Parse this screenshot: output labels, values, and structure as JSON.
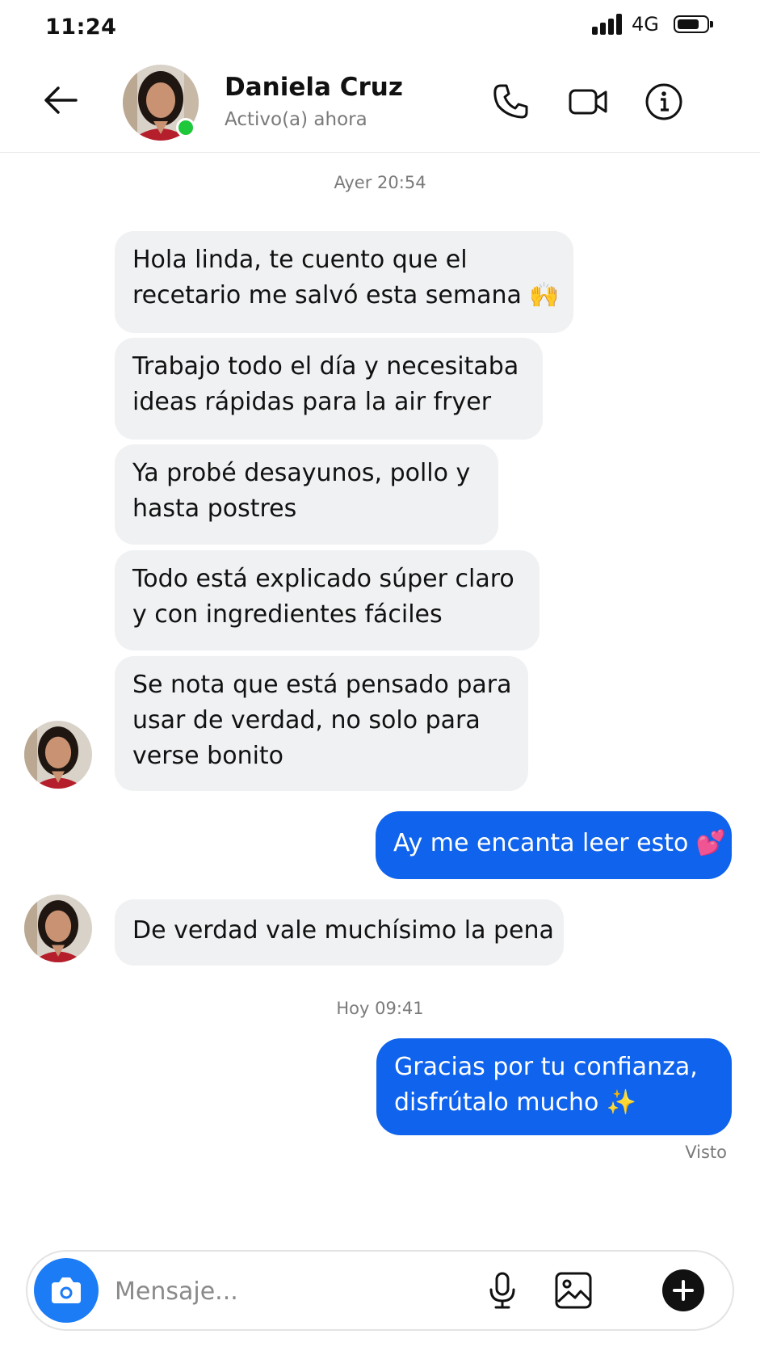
{
  "status_bar": {
    "time": "11:24",
    "network": "4G",
    "battery_level": 0.75
  },
  "header": {
    "contact_name": "Daniela Cruz",
    "contact_status": "Activo(a) ahora",
    "online_color": "#1fc73a",
    "icons": [
      "back-arrow-icon",
      "phone-icon",
      "video-icon",
      "info-icon"
    ]
  },
  "conversation": {
    "timestamp_1": "Ayer 20:54",
    "incoming_1": {
      "line1": "Hola linda, te cuento que el",
      "line2": "recetario me salvó esta semana 🙌"
    },
    "incoming_2": {
      "line1": "Trabajo todo el día y necesitaba",
      "line2": "ideas rápidas para la air fryer"
    },
    "incoming_3": {
      "line1": "Ya probé desayunos, pollo y",
      "line2": "hasta postres"
    },
    "incoming_4": {
      "line1": "Todo está explicado súper claro",
      "line2": "y con ingredientes fáciles"
    },
    "incoming_5": {
      "line1": "Se nota que está pensado para",
      "line2": "usar de verdad, no solo para",
      "line3": "verse bonito"
    },
    "outgoing_1": {
      "line1": "Ay me encanta leer esto 💕"
    },
    "incoming_6": {
      "line1": "De verdad vale muchísimo la pena"
    },
    "timestamp_2": "Hoy 09:41",
    "outgoing_2": {
      "line1": "Gracias por tu confianza,",
      "line2": "disfrútalo mucho ✨"
    },
    "seen_label": "Visto",
    "incoming_color": "#f0f1f3",
    "outgoing_color": "#0f63ec"
  },
  "composer": {
    "placeholder": "Mensaje...",
    "icons": [
      "camera-icon",
      "microphone-icon",
      "gallery-icon",
      "plus-icon"
    ]
  }
}
